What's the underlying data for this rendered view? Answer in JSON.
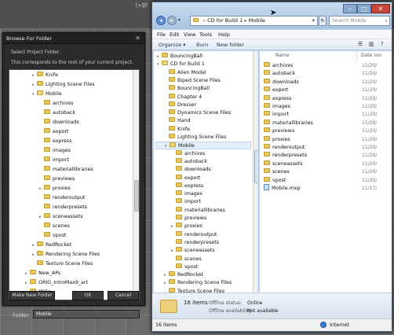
{
  "viewport": {
    "label": "[+][F"
  },
  "browse_dialog": {
    "title": "Browse For Folder",
    "instruction1": "Select Project Folder.",
    "instruction2": "This corresponds to the root of your current project.",
    "tree": [
      {
        "label": "Knife",
        "expander": "▸",
        "indent": 1
      },
      {
        "label": "Lighting Scene Files",
        "expander": "▸",
        "indent": 1
      },
      {
        "label": "Mobile",
        "expander": "▾",
        "indent": 1
      },
      {
        "label": "archives",
        "expander": "",
        "indent": 2
      },
      {
        "label": "autoback",
        "expander": "",
        "indent": 2
      },
      {
        "label": "downloads",
        "expander": "",
        "indent": 2
      },
      {
        "label": "export",
        "expander": "",
        "indent": 2
      },
      {
        "label": "express",
        "expander": "",
        "indent": 2
      },
      {
        "label": "images",
        "expander": "",
        "indent": 2
      },
      {
        "label": "import",
        "expander": "",
        "indent": 2
      },
      {
        "label": "materiallibraries",
        "expander": "",
        "indent": 2
      },
      {
        "label": "previews",
        "expander": "",
        "indent": 2
      },
      {
        "label": "proxies",
        "expander": "▸",
        "indent": 2
      },
      {
        "label": "renderoutput",
        "expander": "",
        "indent": 2
      },
      {
        "label": "renderpresets",
        "expander": "",
        "indent": 2
      },
      {
        "label": "sceneassets",
        "expander": "▸",
        "indent": 2
      },
      {
        "label": "scenes",
        "expander": "",
        "indent": 2
      },
      {
        "label": "vpost",
        "expander": "",
        "indent": 2
      },
      {
        "label": "RedRocket",
        "expander": "▸",
        "indent": 1
      },
      {
        "label": "Rendering Scene Files",
        "expander": "▸",
        "indent": 1
      },
      {
        "label": "Texture Scene Files",
        "expander": "",
        "indent": 1
      },
      {
        "label": "New_APs",
        "expander": "▸",
        "indent": 0
      },
      {
        "label": "ORIG_IntroMax9_art",
        "expander": "▸",
        "indent": 0
      },
      {
        "label": "PDFs",
        "expander": "▸",
        "indent": 0
      }
    ],
    "folder_label": "Folder:",
    "folder_value": "Mobile",
    "make_new_folder": "Make New Folder",
    "ok": "OK",
    "cancel": "Cancel"
  },
  "explorer": {
    "address": [
      "CD for Build 1",
      "Mobile"
    ],
    "search_placeholder": "Search Mobile",
    "menu": [
      "File",
      "Edit",
      "View",
      "Tools",
      "Help"
    ],
    "toolbar": {
      "organize": "Organize",
      "burn": "Burn",
      "new_folder": "New folder"
    },
    "nav_tree": [
      {
        "label": "BouncingBall",
        "indent": 0,
        "expander": "▸"
      },
      {
        "label": "CD for Build 1",
        "indent": 0,
        "expander": "▾"
      },
      {
        "label": "Alien Model",
        "indent": 1,
        "expander": ""
      },
      {
        "label": "Biped Scene Files",
        "indent": 1,
        "expander": ""
      },
      {
        "label": "BouncingBall",
        "indent": 1,
        "expander": ""
      },
      {
        "label": "Chapter 4",
        "indent": 1,
        "expander": ""
      },
      {
        "label": "Dresser",
        "indent": 1,
        "expander": ""
      },
      {
        "label": "Dynamics Scene Files",
        "indent": 1,
        "expander": ""
      },
      {
        "label": "Hand",
        "indent": 1,
        "expander": ""
      },
      {
        "label": "Knife",
        "indent": 1,
        "expander": ""
      },
      {
        "label": "Lighting Scene Files",
        "indent": 1,
        "expander": ""
      },
      {
        "label": "Mobile",
        "indent": 1,
        "expander": "▾",
        "selected": true
      },
      {
        "label": "archives",
        "indent": 2,
        "expander": ""
      },
      {
        "label": "autoback",
        "indent": 2,
        "expander": ""
      },
      {
        "label": "downloads",
        "indent": 2,
        "expander": ""
      },
      {
        "label": "export",
        "indent": 2,
        "expander": ""
      },
      {
        "label": "express",
        "indent": 2,
        "expander": ""
      },
      {
        "label": "images",
        "indent": 2,
        "expander": ""
      },
      {
        "label": "import",
        "indent": 2,
        "expander": ""
      },
      {
        "label": "materiallibraries",
        "indent": 2,
        "expander": ""
      },
      {
        "label": "previews",
        "indent": 2,
        "expander": ""
      },
      {
        "label": "proxies",
        "indent": 2,
        "expander": "▸"
      },
      {
        "label": "renderoutput",
        "indent": 2,
        "expander": ""
      },
      {
        "label": "renderpresets",
        "indent": 2,
        "expander": ""
      },
      {
        "label": "sceneassets",
        "indent": 2,
        "expander": "▸"
      },
      {
        "label": "scenes",
        "indent": 2,
        "expander": ""
      },
      {
        "label": "vpost",
        "indent": 2,
        "expander": ""
      },
      {
        "label": "RedRocket",
        "indent": 1,
        "expander": "▸"
      },
      {
        "label": "Rendering Scene Files",
        "indent": 1,
        "expander": "▸"
      },
      {
        "label": "Texture Scene Files",
        "indent": 1,
        "expander": ""
      }
    ],
    "columns": {
      "name": "Name",
      "date": "Date mo"
    },
    "files": [
      {
        "name": "archives",
        "date": "11/20/",
        "type": "folder"
      },
      {
        "name": "autoback",
        "date": "11/20/",
        "type": "folder"
      },
      {
        "name": "downloads",
        "date": "11/20/",
        "type": "folder"
      },
      {
        "name": "export",
        "date": "11/20/",
        "type": "folder"
      },
      {
        "name": "express",
        "date": "11/20/",
        "type": "folder"
      },
      {
        "name": "images",
        "date": "11/20/",
        "type": "folder"
      },
      {
        "name": "import",
        "date": "11/20/",
        "type": "folder"
      },
      {
        "name": "materiallibraries",
        "date": "11/20/",
        "type": "folder"
      },
      {
        "name": "previews",
        "date": "11/20/",
        "type": "folder"
      },
      {
        "name": "proxies",
        "date": "11/20/",
        "type": "folder"
      },
      {
        "name": "renderoutput",
        "date": "11/20/",
        "type": "folder"
      },
      {
        "name": "renderpresets",
        "date": "11/20/",
        "type": "folder"
      },
      {
        "name": "sceneassets",
        "date": "11/20/",
        "type": "folder"
      },
      {
        "name": "scenes",
        "date": "11/20/",
        "type": "folder"
      },
      {
        "name": "vpost",
        "date": "11/20/",
        "type": "folder"
      },
      {
        "name": "Mobile.mxp",
        "date": "11/17/",
        "type": "file"
      }
    ],
    "details": {
      "items": "16 items",
      "offline_status_label": "Offline status:",
      "offline_status_value": "Online",
      "offline_avail_label": "Offline availability:",
      "offline_avail_value": "Not available"
    },
    "status": {
      "items": "16 items",
      "zone": "Internet"
    }
  }
}
